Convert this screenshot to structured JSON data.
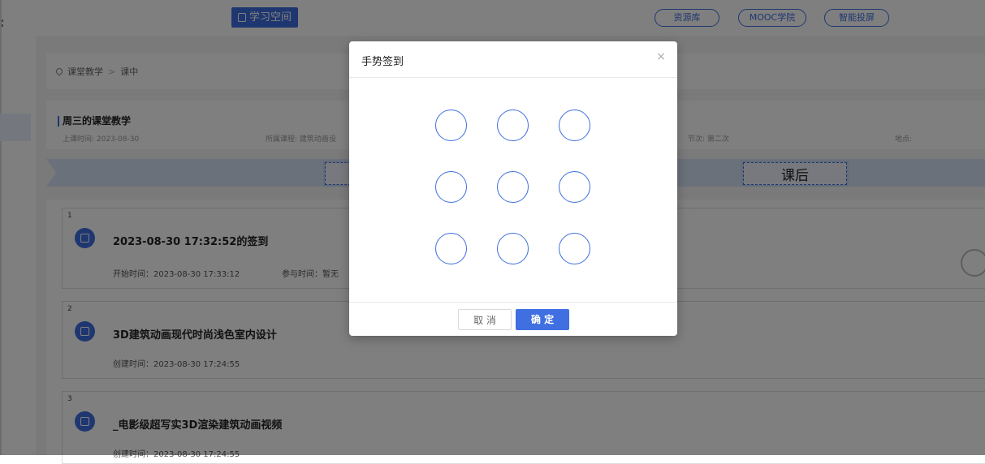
{
  "header": {
    "brand": "学习空间",
    "nav": [
      "资源库",
      "MOOC学院",
      "智能投屏"
    ]
  },
  "breadcrumb": {
    "items": [
      "课堂教学",
      "课中"
    ],
    "separator": ">"
  },
  "lesson": {
    "title": "周三的课堂教学",
    "date": "上课时间: 2023-08-30",
    "course": "所属课程: 建筑动画设",
    "period": "节次: 第二次",
    "location": "地点:"
  },
  "stages": {
    "after": "课后"
  },
  "cards": [
    {
      "num": "1",
      "title": "2023-08-30 17:32:52的签到",
      "meta": "开始时间：2023-08-30 17:33:12",
      "meta2": "参与时间：暂无"
    },
    {
      "num": "2",
      "title": "3D建筑动画现代时尚浅色室内设计",
      "meta": "创建时间：2023-08-30 17:24:55"
    },
    {
      "num": "3",
      "title": "_电影级超写实3D渲染建筑动画视频",
      "meta": "创建时间：2023-08-30 17:24:55"
    }
  ],
  "modal": {
    "title": "手势签到",
    "close": "×",
    "cancel": "取 消",
    "confirm": "确 定"
  },
  "colors": {
    "accent": "#3f6fe0",
    "overlay": "rgba(0,0,0,0.5)"
  },
  "icons": [
    "book-icon",
    "pin-icon",
    "calendar-check-icon",
    "document-icon",
    "close-icon"
  ]
}
